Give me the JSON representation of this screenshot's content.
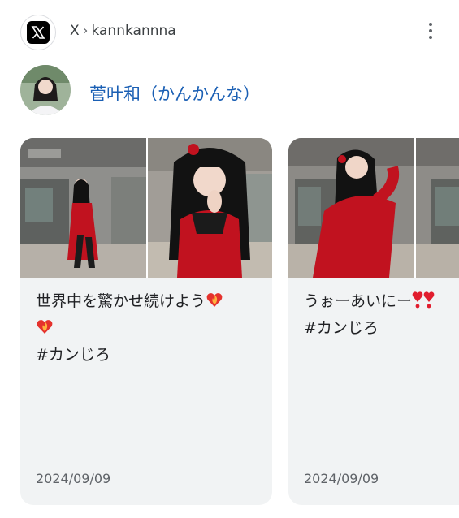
{
  "header": {
    "source": "X",
    "separator": "›",
    "account": "kannkannna",
    "more_icon": "more-vert-icon"
  },
  "profile": {
    "name": "菅叶和（かんかんな）"
  },
  "cards": [
    {
      "text_line1": "世界中を驚かせ続けよう",
      "hashtag": "#カンじろ",
      "date": "2024/09/09"
    },
    {
      "text_line1": "うぉーあいにー",
      "hashtag": "#カンじろ",
      "date": "2024/09/09"
    }
  ],
  "colors": {
    "link_blue": "#1a5fb4",
    "card_bg": "#f1f3f4",
    "dress_red": "#c1121f"
  }
}
